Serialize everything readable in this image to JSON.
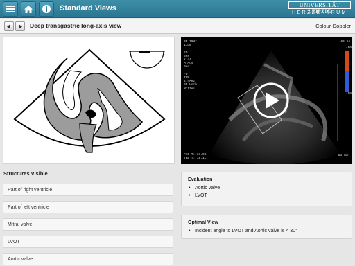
{
  "header": {
    "title": "Standard Views",
    "logo_line1": "UNIVERSITÄT LEIPZIG",
    "logo_line2": "HERZZENTRUM",
    "icons": [
      "menu-icon",
      "home-icon",
      "info-icon"
    ],
    "colors": {
      "bar": "#2f7f9c",
      "text": "#ffffff"
    }
  },
  "subheader": {
    "view_name": "Deep transgastric long-axis view",
    "mode": "Colour-Doppler",
    "icons": [
      "chevron-left-icon",
      "chevron-right-icon"
    ]
  },
  "echo": {
    "overlay_left": [
      "BF 19Hz",
      "11cm",
      "",
      "2D",
      "56%",
      "K 44",
      "M Aus",
      "Pen",
      "",
      "FD",
      "70%",
      "4.4MHz",
      "BF Hoch",
      "Mittel"
    ],
    "overlay_right_top": "64 64",
    "overlay_right_scale": [
      "+50",
      "-50"
    ],
    "overlay_bottom_left": [
      "PAT T: 37.0C",
      "TEE T: 38.1C"
    ],
    "overlay_bottom_right": "83 min",
    "icons": [
      "play-icon"
    ]
  },
  "structures": {
    "title": "Structures Visible",
    "items": [
      "Part of right ventricle",
      "Part of left ventricle",
      "Mitral valve",
      "LVOT",
      "Aortic valve"
    ]
  },
  "evaluation": {
    "title": "Evaluation",
    "items": [
      "Aortic valve",
      "LVOT"
    ]
  },
  "optimal_view": {
    "title": "Optimal View",
    "items": [
      "Incident angle to LVOT and Aortic valve is < 30°"
    ]
  }
}
